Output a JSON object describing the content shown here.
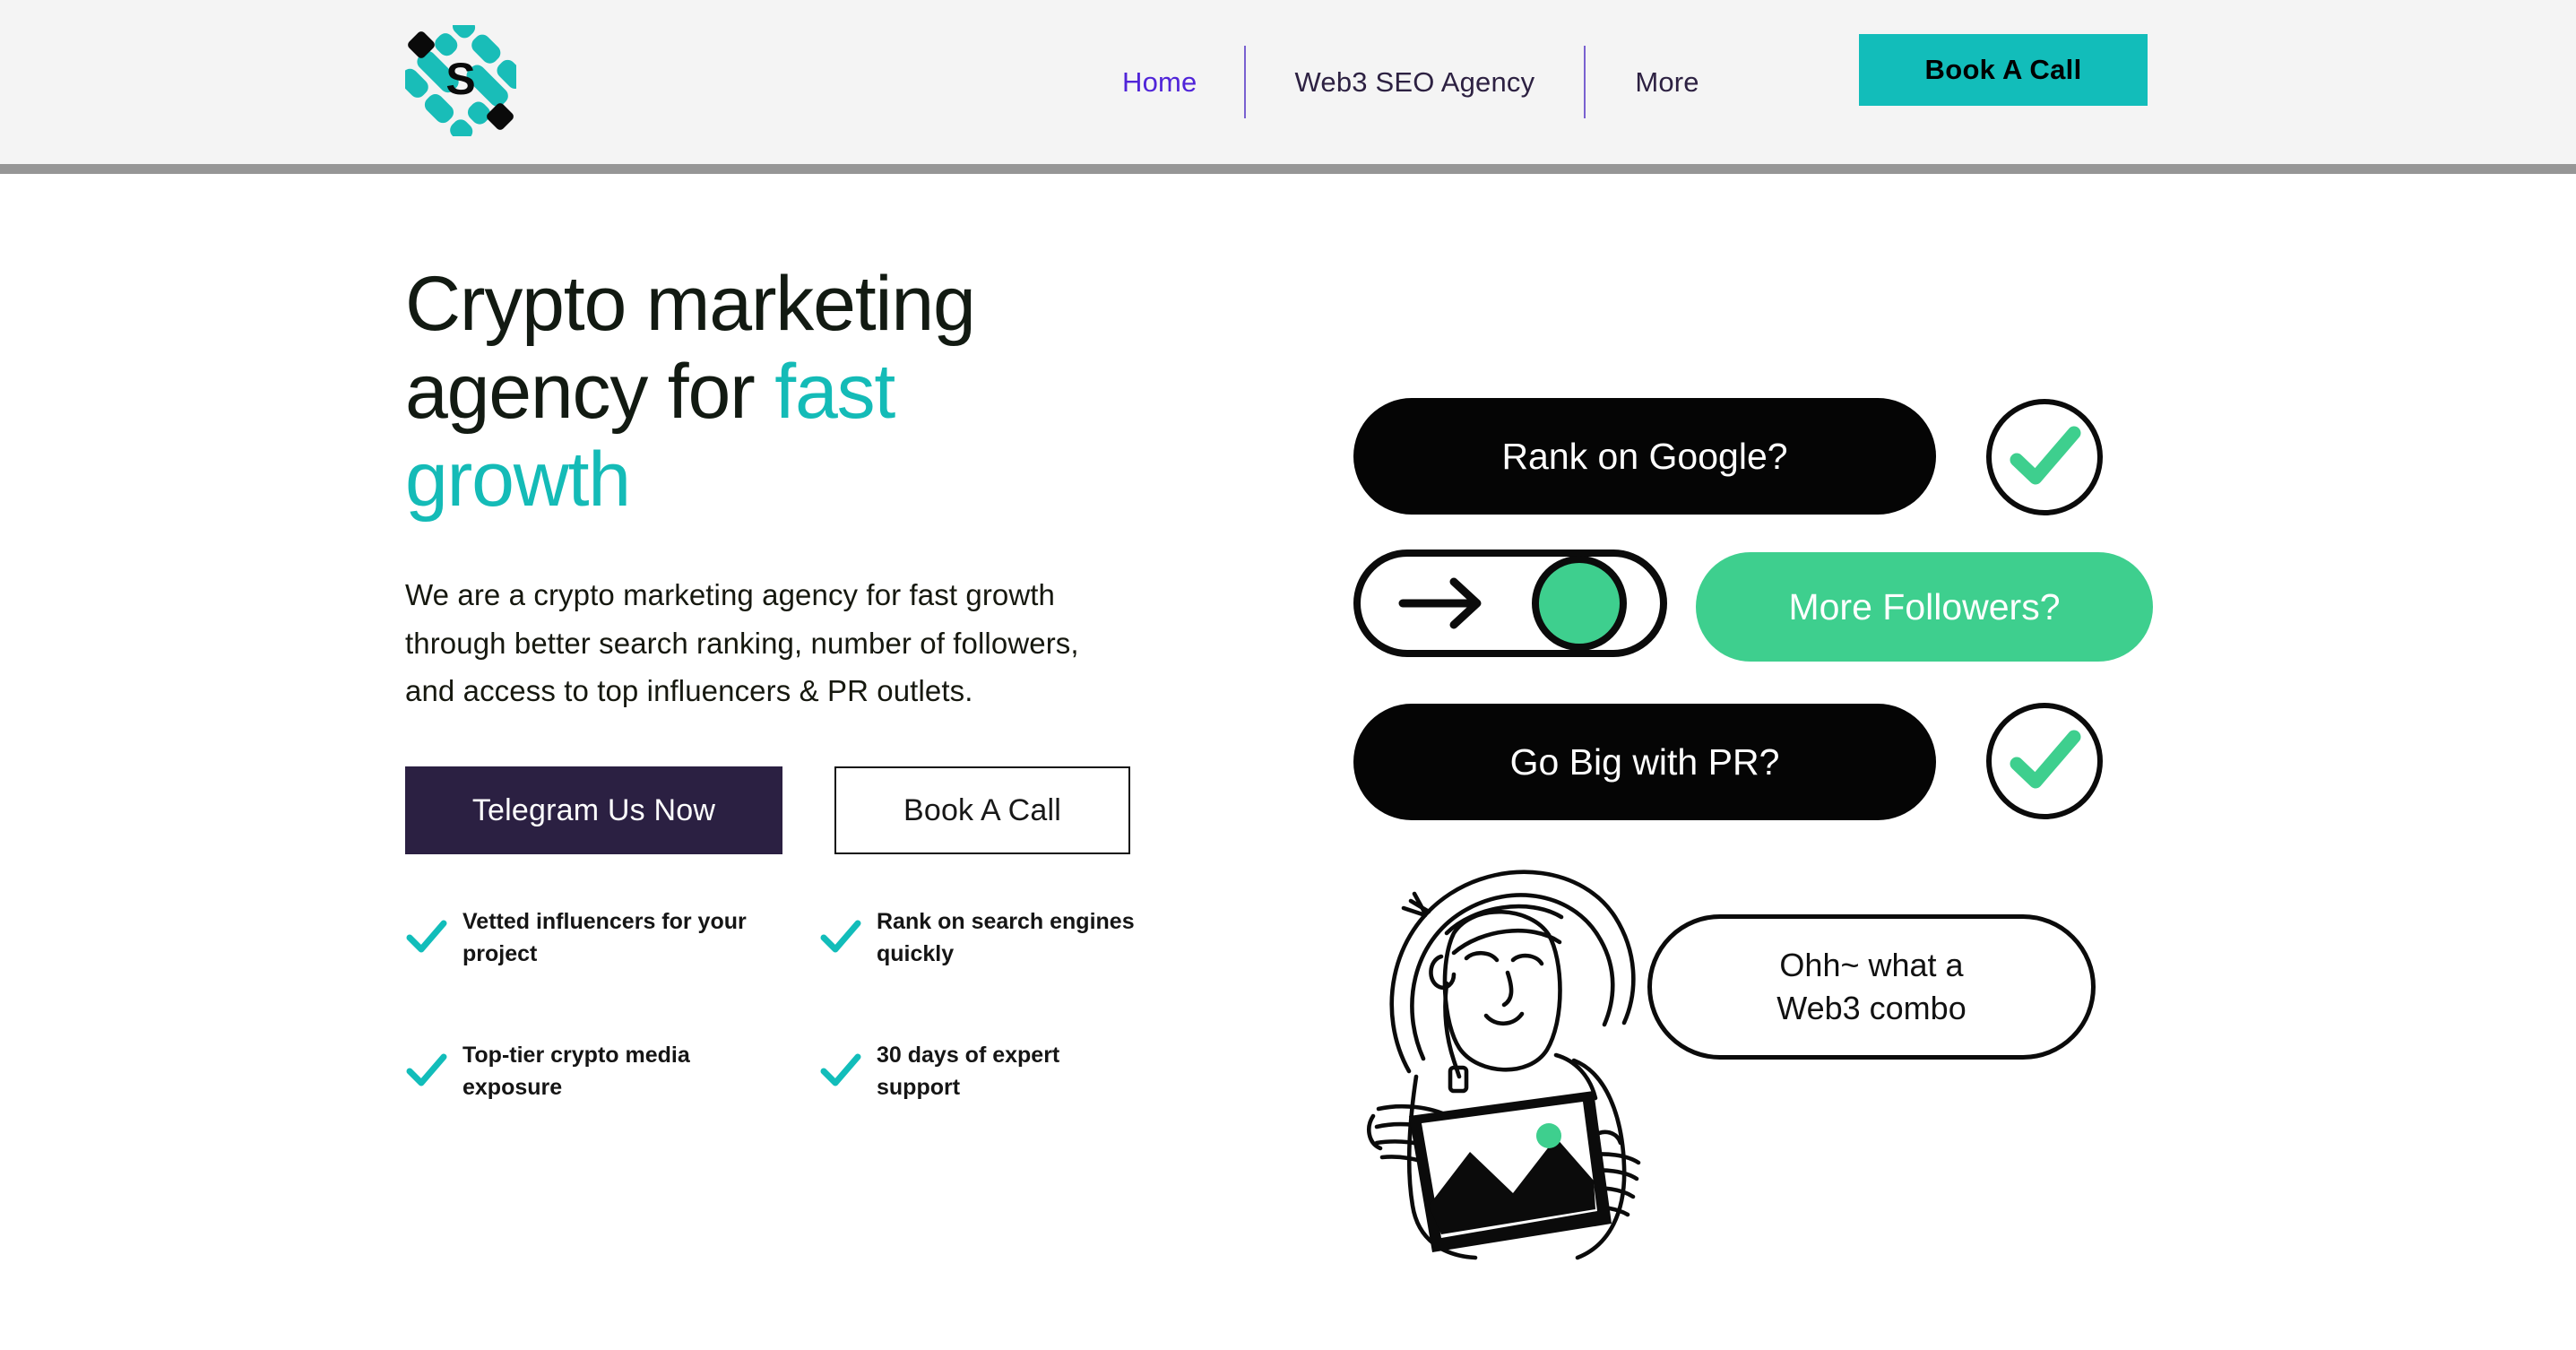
{
  "colors": {
    "header_bg": "#f4f4f4",
    "header_rule": "#969696",
    "teal": "#12bdba",
    "teal_accent": "#14bbb7",
    "nav_active": "#5024d8",
    "nav_text": "#2d2142",
    "telegram_btn_bg": "#2b2042",
    "pill_dark": "#050505",
    "pill_green": "#3ecf8e",
    "check_green": "#3ecf8e",
    "body_text": "#16180f"
  },
  "header": {
    "logo_icon": "logo-s-diamond-icon",
    "logo_letter": "S",
    "nav": [
      {
        "label": "Home",
        "active": true
      },
      {
        "label": "Web3 SEO Agency",
        "active": false
      },
      {
        "label": "More",
        "active": false
      }
    ],
    "cta_label": "Book A Call"
  },
  "hero": {
    "title_part1": "Crypto marketing agency for ",
    "title_accent1": "fast growth",
    "subtitle": "We are a crypto marketing agency for fast growth through better search ranking, number of followers, and access to top influencers & PR outlets.",
    "primary_button": "Telegram Us Now",
    "secondary_button": "Book A Call",
    "features": [
      {
        "icon": "check-icon",
        "label": "Vetted influencers for your project"
      },
      {
        "icon": "check-icon",
        "label": "Rank on search engines quickly"
      },
      {
        "icon": "check-icon",
        "label": "Top-tier crypto media exposure"
      },
      {
        "icon": "check-icon",
        "label": "30 days of expert support"
      }
    ]
  },
  "illustration": {
    "pill_rank": "Rank on Google?",
    "pill_followers": "More Followers?",
    "pill_pr": "Go Big with PR?",
    "speech_bubble_line1": "Ohh~ what a",
    "speech_bubble_line2": "Web3 combo",
    "toggle_icon": "arrow-right-icon",
    "toggle_state": "on",
    "check_rank_icon": "check-circle-icon",
    "check_pr_icon": "check-circle-icon",
    "person_icon": "person-with-tablet-icon",
    "tablet_chart_icon": "mountain-chart-icon",
    "tablet_dot_color": "#3ecf8e"
  }
}
